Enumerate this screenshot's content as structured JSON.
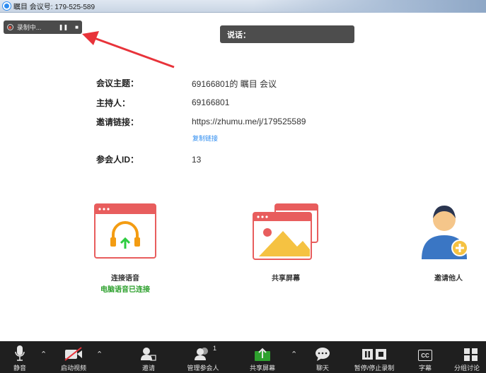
{
  "window": {
    "title": "瞩目 会议号: 179-525-589"
  },
  "recording": {
    "status": "录制中...",
    "pause_glyph": "❚❚",
    "stop_glyph": "■"
  },
  "speaking": {
    "label": "说话："
  },
  "meeting": {
    "topic_label": "会议主题：",
    "topic_value": "69166801的 瞩目 会议",
    "host_label": "主持人：",
    "host_value": "69166801",
    "invite_label": "邀请链接：",
    "invite_value": "https://zhumu.me/j/179525589",
    "copy_link": "复制链接",
    "participant_label": "参会人ID：",
    "participant_value": "13"
  },
  "tiles": {
    "audio": {
      "label": "连接语音",
      "sub": "电脑语音已连接"
    },
    "share": {
      "label": "共享屏幕"
    },
    "invite": {
      "label": "邀请他人"
    }
  },
  "toolbar": {
    "mute": "静音",
    "video": "启动视频",
    "invite": "邀请",
    "participants": "管理参会人",
    "participants_count": "1",
    "share": "共享屏幕",
    "chat": "聊天",
    "record": "暂停/停止录制",
    "cc_glyph": "CC",
    "cc": "字幕",
    "breakout": "分组讨论"
  },
  "colors": {
    "accent": "#2d8cf0",
    "connected": "#2ea12e",
    "tile_red": "#e85d5d",
    "toolbar": "#1f1f1f"
  }
}
